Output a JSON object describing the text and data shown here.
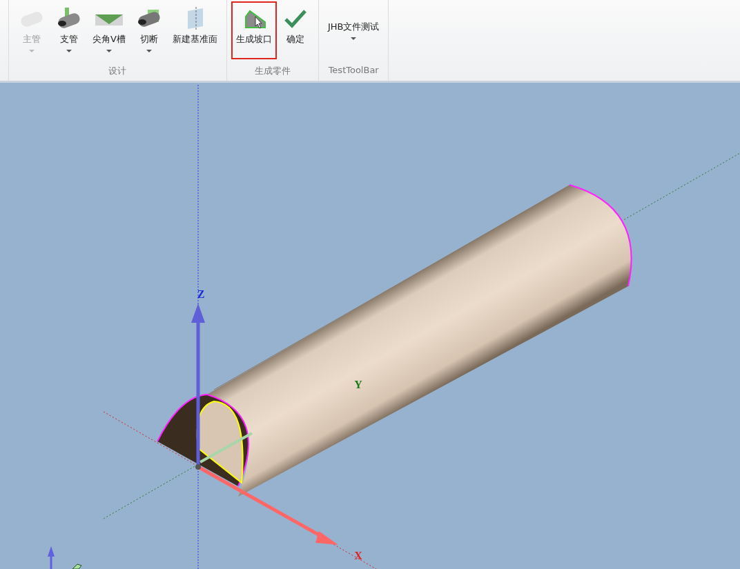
{
  "ribbon": {
    "groups": [
      {
        "label": "设计",
        "buttons": [
          {
            "label": "主管",
            "kind": "pipe",
            "disabled": true,
            "dropdown": true,
            "highlighted": false
          },
          {
            "label": "支管",
            "kind": "branch",
            "disabled": false,
            "dropdown": true,
            "highlighted": false
          },
          {
            "label": "尖角V槽",
            "kind": "vgroove",
            "disabled": false,
            "dropdown": true,
            "highlighted": false
          },
          {
            "label": "切断",
            "kind": "cut",
            "disabled": false,
            "dropdown": true,
            "highlighted": false
          },
          {
            "label": "新建基准面",
            "kind": "plane",
            "disabled": false,
            "dropdown": false,
            "highlighted": false
          }
        ]
      },
      {
        "label": "生成零件",
        "buttons": [
          {
            "label": "生成坡口",
            "kind": "bevel",
            "disabled": false,
            "dropdown": false,
            "highlighted": true
          },
          {
            "label": "确定",
            "kind": "check",
            "disabled": false,
            "dropdown": false,
            "highlighted": false
          }
        ]
      },
      {
        "label": "TestToolBar",
        "buttons": [
          {
            "label": "JHB文件测试",
            "kind": "text",
            "disabled": false,
            "dropdown": true,
            "highlighted": false
          }
        ]
      }
    ]
  },
  "viewport": {
    "axis_labels": [
      {
        "kind": "z",
        "text": "Z"
      },
      {
        "kind": "y",
        "text": "Y"
      },
      {
        "kind": "x",
        "text": "X"
      }
    ]
  }
}
